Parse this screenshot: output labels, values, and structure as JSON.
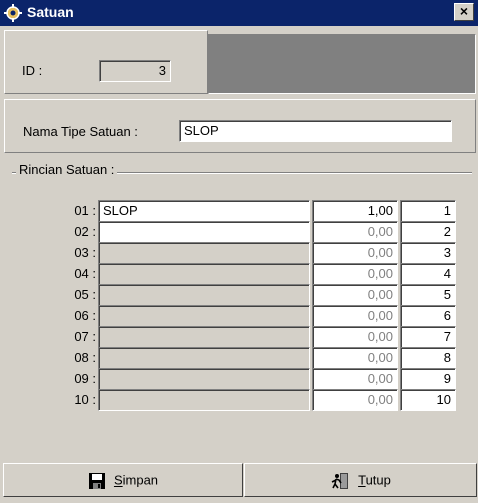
{
  "window": {
    "title": "Satuan",
    "close_glyph": "×",
    "icon": "app-icon"
  },
  "id_section": {
    "label": "ID :",
    "value": "3"
  },
  "nama_tipe": {
    "label": "Nama Tipe Satuan :",
    "value": "SLOP"
  },
  "rincian": {
    "group_label": "Rincian Satuan :",
    "rows": [
      {
        "num": "01 :",
        "name": "SLOP",
        "qty": "1,00",
        "index": "1",
        "active": true
      },
      {
        "num": "02 :",
        "name": "",
        "qty": "0,00",
        "index": "2",
        "active": false
      },
      {
        "num": "03 :",
        "name": "",
        "qty": "0,00",
        "index": "3",
        "active": false
      },
      {
        "num": "04 :",
        "name": "",
        "qty": "0,00",
        "index": "4",
        "active": false
      },
      {
        "num": "05 :",
        "name": "",
        "qty": "0,00",
        "index": "5",
        "active": false
      },
      {
        "num": "06 :",
        "name": "",
        "qty": "0,00",
        "index": "6",
        "active": false
      },
      {
        "num": "07 :",
        "name": "",
        "qty": "0,00",
        "index": "7",
        "active": false
      },
      {
        "num": "08 :",
        "name": "",
        "qty": "0,00",
        "index": "8",
        "active": false
      },
      {
        "num": "09 :",
        "name": "",
        "qty": "0,00",
        "index": "9",
        "active": false
      },
      {
        "num": "10 :",
        "name": "",
        "qty": "0,00",
        "index": "10",
        "active": false
      }
    ]
  },
  "buttons": {
    "simpan": {
      "mnemonic": "S",
      "rest": "impan",
      "icon": "save-disk-icon"
    },
    "tutup": {
      "mnemonic": "T",
      "rest": "utup",
      "icon": "exit-door-icon"
    }
  },
  "colors": {
    "titlebar": "#0b246a",
    "face": "#d4d0c8",
    "header_panel": "#808080"
  }
}
